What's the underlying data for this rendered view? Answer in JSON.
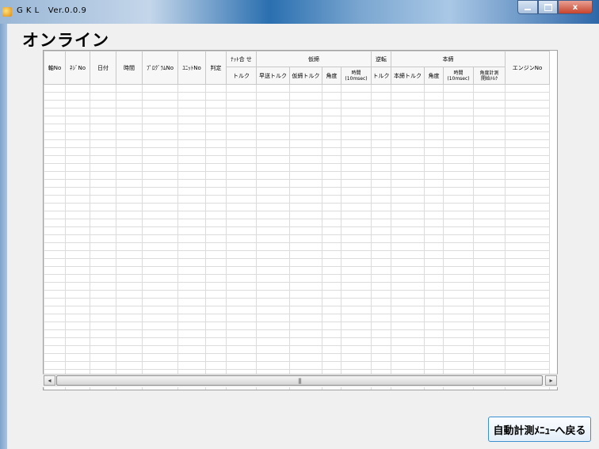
{
  "window": {
    "title": "G K L   Ver.0.0.9",
    "min_label": "",
    "max_label": "",
    "close_label": "x"
  },
  "page": {
    "title": "オンライン"
  },
  "table": {
    "group_headers": {
      "nutrunner": "ﾅｯﾄ合 せ",
      "kari_shime": "仮締",
      "gyakuten": "逆転",
      "hon_shime": "本締"
    },
    "col_headers": {
      "jiku_no": "軸No",
      "neji_no": "ﾈｼﾞNo",
      "hizuke": "日付",
      "jikoku": "時間",
      "program_no": "ﾌﾟﾛｸﾞﾗﾑNo",
      "unit_no": "ﾕﾆｯﾄNo",
      "hantei": "判定",
      "torque": "トルク",
      "hayaokuri_torque": "早送トルク",
      "karishime_torque": "仮締トルク",
      "kakudo_1": "角度",
      "jikan_1": "時間",
      "jikan_1_unit": "(10msec)",
      "gyakuten_torque": "トルク",
      "honshime_torque": "本締トルク",
      "kakudo_2": "角度",
      "jikan_2": "時間",
      "jikan_2_unit": "(10msec)",
      "kakudo_keisoku": "角度計測",
      "kakudo_keisoku_2": "開始ﾄﾙｸ",
      "engine_no": "エンジンNo"
    },
    "rows": []
  },
  "scrollbar": {
    "left_arrow": "◂",
    "right_arrow": "▸",
    "grip": "|||"
  },
  "buttons": {
    "back_label": "自動計測ﾒﾆｭｰへ戻る"
  }
}
